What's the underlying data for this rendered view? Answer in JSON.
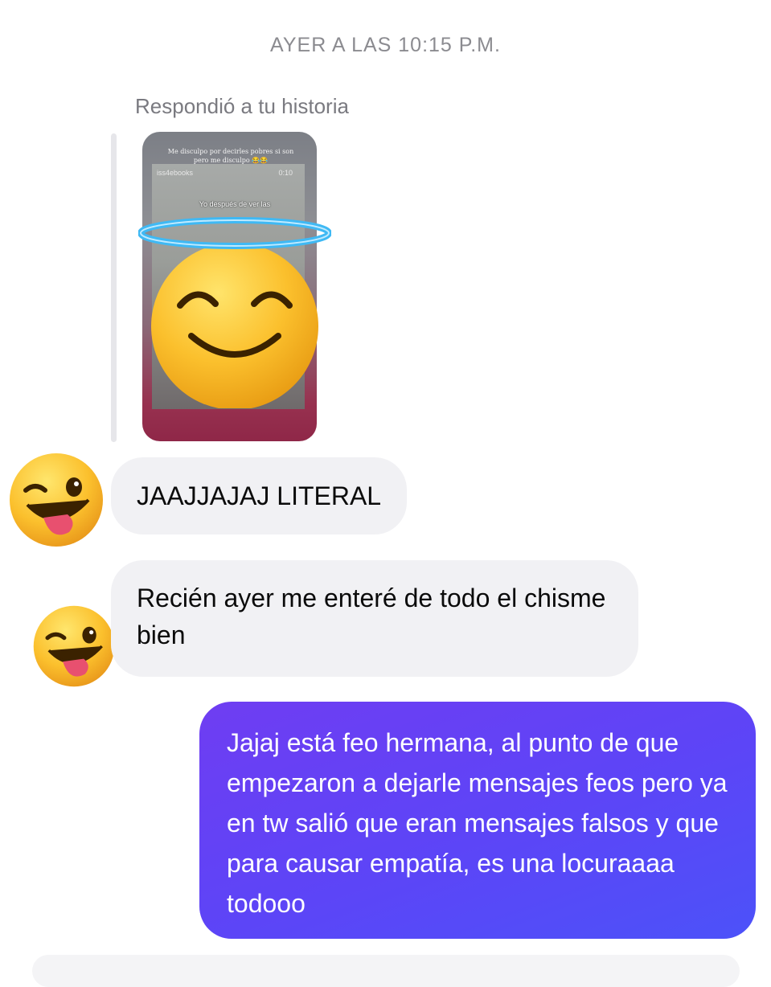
{
  "header": {
    "timestamp": "AYER A LAS 10:15 P.M."
  },
  "story_reply": {
    "label": "Respondió a tu historia",
    "story": {
      "caption": "Me disculpo por decirles pobres si son pero me disculpo 😂😂",
      "handle": "iss4ebooks",
      "duration": "0:10",
      "overlay_text": "Yo después de ver las"
    },
    "reaction_icon": "smiling-face-with-halo"
  },
  "messages": [
    {
      "from": "other",
      "avatar_icon": "winking-face-with-tongue",
      "text": "JAAJJAJAJ LITERAL"
    },
    {
      "from": "other",
      "avatar_icon": "winking-face-with-tongue",
      "text": "Recién ayer me enteré de todo el chisme bien"
    },
    {
      "from": "me",
      "text": "Jajaj está feo hermana, al punto de que empezaron a dejarle mensajes feos pero ya en tw salió que eran mensajes falsos y que para causar empatía, es una locuraaaa todooo"
    }
  ],
  "colors": {
    "incoming_bubble": "#f1f1f4",
    "outgoing_bubble_start": "#6f3df2",
    "outgoing_bubble_end": "#4c52f9",
    "meta_text": "#8b8b90"
  }
}
